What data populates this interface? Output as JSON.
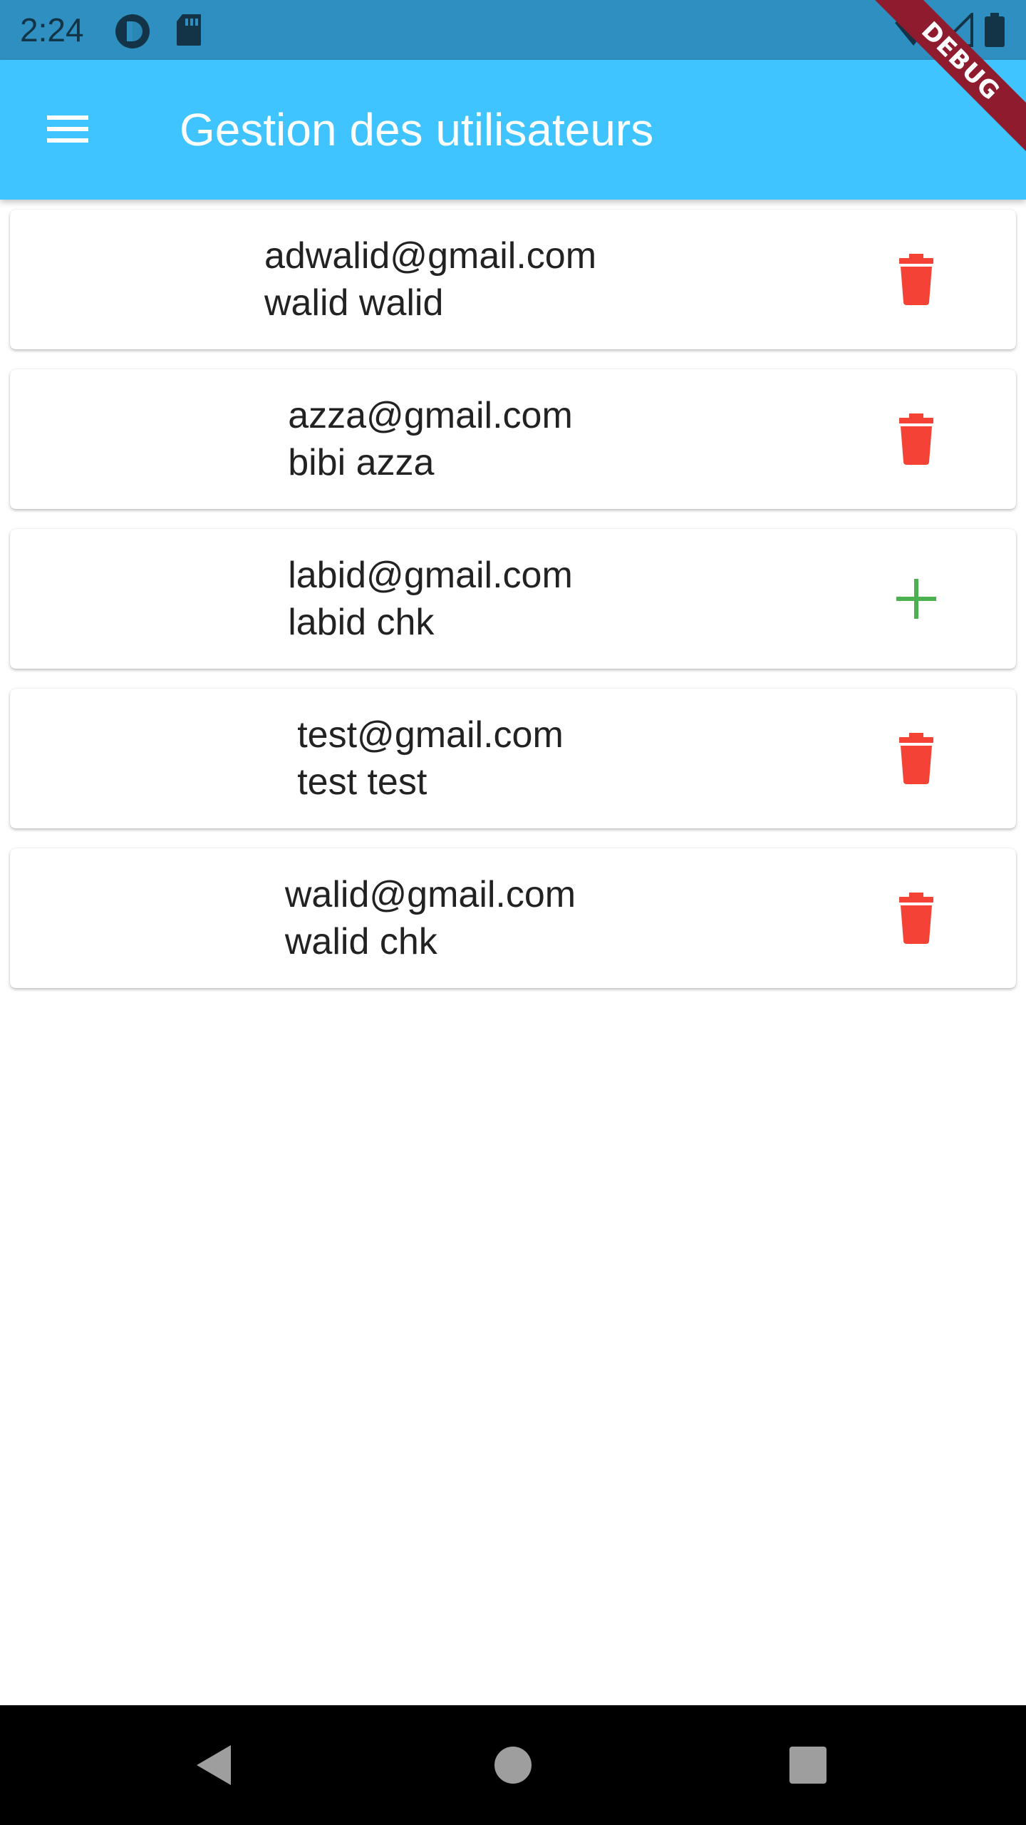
{
  "status_bar": {
    "time": "2:24",
    "icons": [
      "app-notification-icon",
      "sd-card-icon",
      "wifi-icon",
      "signal-icon",
      "battery-icon"
    ]
  },
  "app_bar": {
    "title": "Gestion des utilisateurs",
    "menu_icon": "menu-icon",
    "color": "#40c4ff"
  },
  "debug_banner": "DEBUG",
  "users": [
    {
      "email": "adwalid@gmail.com",
      "name": "walid walid",
      "action": "delete",
      "action_icon": "trash-icon"
    },
    {
      "email": "azza@gmail.com",
      "name": "bibi azza",
      "action": "delete",
      "action_icon": "trash-icon"
    },
    {
      "email": "labid@gmail.com",
      "name": "labid chk",
      "action": "add",
      "action_icon": "plus-icon"
    },
    {
      "email": "test@gmail.com",
      "name": "test test",
      "action": "delete",
      "action_icon": "trash-icon"
    },
    {
      "email": "walid@gmail.com",
      "name": "walid chk",
      "action": "delete",
      "action_icon": "trash-icon"
    }
  ],
  "colors": {
    "delete": "#f44336",
    "add": "#4caf50",
    "status_bar": "#2e8fc0"
  },
  "nav_bar": {
    "buttons": [
      "back-icon",
      "home-icon",
      "recents-icon"
    ]
  }
}
